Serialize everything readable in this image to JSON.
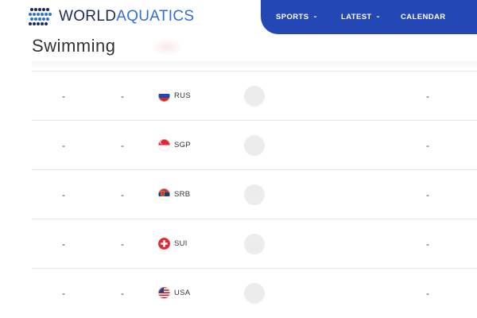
{
  "brand": {
    "part1": "WORLD",
    "part2": "AQUATICS"
  },
  "nav": {
    "sports": "SPORTS",
    "latest": "LATEST",
    "calendar": "CALENDAR"
  },
  "page": {
    "title": "Swimming"
  },
  "rows": [
    {
      "col1": "-",
      "col2": "-",
      "country": "RUS",
      "flag_icon": "flag-russia",
      "col_last": "-"
    },
    {
      "col1": "-",
      "col2": "-",
      "country": "SGP",
      "flag_icon": "flag-singapore",
      "col_last": "-"
    },
    {
      "col1": "-",
      "col2": "-",
      "country": "SRB",
      "flag_icon": "flag-serbia",
      "col_last": "-"
    },
    {
      "col1": "-",
      "col2": "-",
      "country": "SUI",
      "flag_icon": "flag-switzerland",
      "col_last": "-"
    },
    {
      "col1": "-",
      "col2": "-",
      "country": "USA",
      "flag_icon": "flag-usa",
      "col_last": "-"
    }
  ],
  "colors": {
    "nav_bg": "#2347b4",
    "brand_dark": "#1c2a5a",
    "brand_blue": "#2f6fd6"
  }
}
